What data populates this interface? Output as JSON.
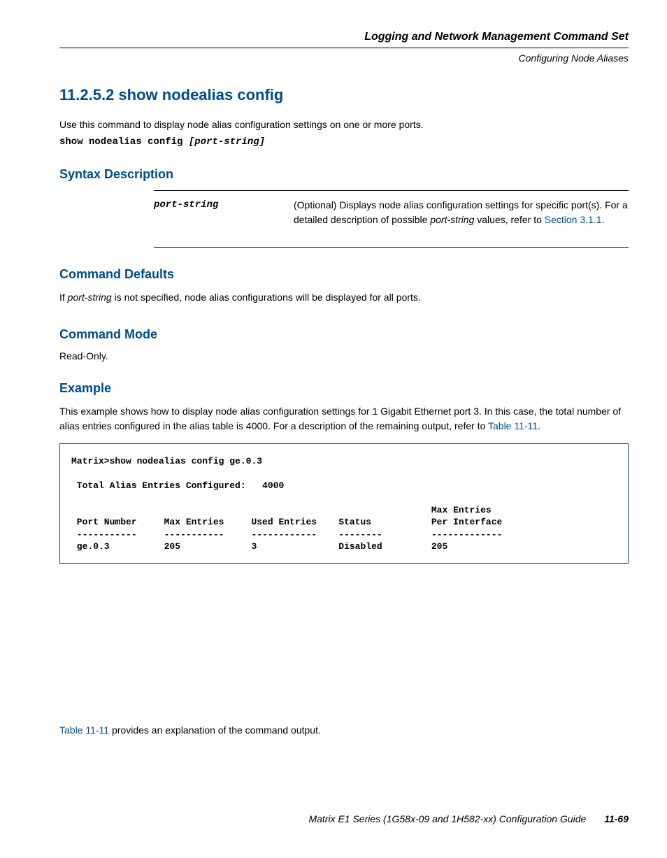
{
  "header": {
    "title": "Logging and Network Management Command Set",
    "subtitle": "Configuring Node Aliases"
  },
  "section": {
    "number_title": "11.2.5.2  show nodealias config"
  },
  "intro": {
    "text": "Use this command to display node alias configuration settings on one or more ports."
  },
  "syntax": {
    "prefix": "show nodealias config ",
    "param": "[port-string]"
  },
  "headings": {
    "syntax_desc": "Syntax Description",
    "cmd_defaults": "Command Defaults",
    "cmd_mode": "Command Mode",
    "example": "Example"
  },
  "syntax_table": {
    "param": "port-string",
    "desc_before": "(Optional) Displays node alias configuration settings for specific port(s). For a detailed description of possible ",
    "desc_italic": "port-string",
    "desc_after_1": " values, refer to ",
    "desc_link": "Section 3.1.1",
    "desc_after_2": "."
  },
  "cmd_defaults": {
    "before": "If ",
    "italic": "port-string",
    "after": " is not specified, node alias configurations will be displayed for all ports."
  },
  "cmd_mode": {
    "text": "Read-Only."
  },
  "example": {
    "text_before": "This example shows how to display node alias configuration settings for 1 Gigabit Ethernet port 3. In this case, the total number of alias entries configured in the alias table is 4000. For a description of the remaining output, refer to "
  },
  "example_output": "Matrix>show nodealias config ge.0.3\n\n Total Alias Entries Configured:   4000\n\n                                                                  Max Entries\n Port Number     Max Entries     Used Entries    Status           Per Interface\n -----------     -----------     ------------    --------         -------------\n ge.0.3          205             3               Disabled         205",
  "table_ref": {
    "before": "",
    "link": "Table 11-11",
    "after": "."
  },
  "table_desc": {
    "link": "Table 11-11",
    "after": " provides an explanation of the command output."
  },
  "footer": {
    "title": "Matrix E1 Series (1G58x-09 and 1H582-xx) Configuration Guide",
    "page": "11-69"
  }
}
